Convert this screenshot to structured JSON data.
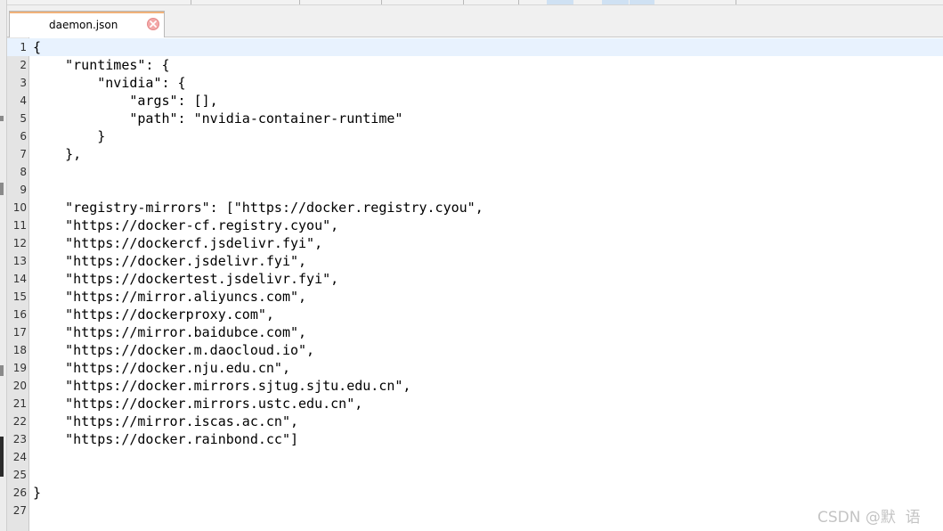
{
  "tab": {
    "filename": "daemon.json",
    "close_icon": "close-icon"
  },
  "editor": {
    "current_line": 1,
    "lines": [
      {
        "n": "1",
        "text": "{"
      },
      {
        "n": "2",
        "text": "    \"runtimes\": {"
      },
      {
        "n": "3",
        "text": "        \"nvidia\": {"
      },
      {
        "n": "4",
        "text": "            \"args\": [],"
      },
      {
        "n": "5",
        "text": "            \"path\": \"nvidia-container-runtime\""
      },
      {
        "n": "6",
        "text": "        }"
      },
      {
        "n": "7",
        "text": "    },"
      },
      {
        "n": "8",
        "text": ""
      },
      {
        "n": "9",
        "text": ""
      },
      {
        "n": "10",
        "text": "    \"registry-mirrors\": [\"https://docker.registry.cyou\","
      },
      {
        "n": "11",
        "text": "    \"https://docker-cf.registry.cyou\","
      },
      {
        "n": "12",
        "text": "    \"https://dockercf.jsdelivr.fyi\","
      },
      {
        "n": "13",
        "text": "    \"https://docker.jsdelivr.fyi\","
      },
      {
        "n": "14",
        "text": "    \"https://dockertest.jsdelivr.fyi\","
      },
      {
        "n": "15",
        "text": "    \"https://mirror.aliyuncs.com\","
      },
      {
        "n": "16",
        "text": "    \"https://dockerproxy.com\","
      },
      {
        "n": "17",
        "text": "    \"https://mirror.baidubce.com\","
      },
      {
        "n": "18",
        "text": "    \"https://docker.m.daocloud.io\","
      },
      {
        "n": "19",
        "text": "    \"https://docker.nju.edu.cn\","
      },
      {
        "n": "20",
        "text": "    \"https://docker.mirrors.sjtug.sjtu.edu.cn\","
      },
      {
        "n": "21",
        "text": "    \"https://docker.mirrors.ustc.edu.cn\","
      },
      {
        "n": "22",
        "text": "    \"https://mirror.iscas.ac.cn\","
      },
      {
        "n": "23",
        "text": "    \"https://docker.rainbond.cc\"]"
      },
      {
        "n": "24",
        "text": ""
      },
      {
        "n": "25",
        "text": ""
      },
      {
        "n": "26",
        "text": "}"
      },
      {
        "n": "27",
        "text": ""
      }
    ]
  },
  "watermark": "CSDN @默  语",
  "colors": {
    "current_line_bg": "#e8f2fe",
    "gutter_bg": "#e4e4e4",
    "tab_accent": "#f0b27a"
  }
}
